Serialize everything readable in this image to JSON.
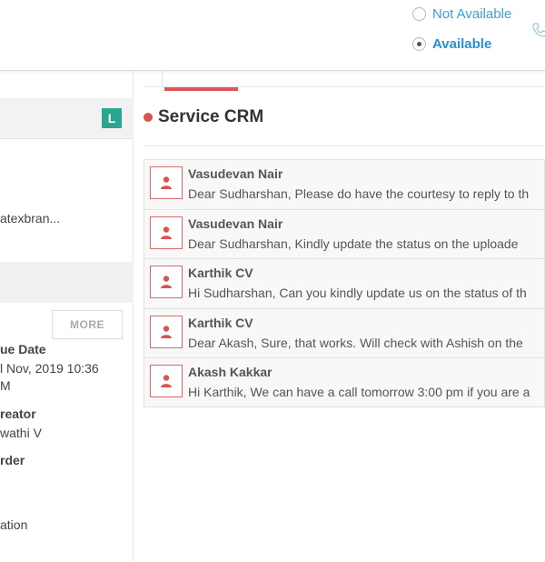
{
  "presence": {
    "options": [
      {
        "label": "Not Available",
        "selected": false
      },
      {
        "label": "Available",
        "selected": true
      }
    ]
  },
  "left_panel": {
    "badge": "L",
    "field_1": "atexbran...",
    "more_button": "MORE",
    "due_date_label": "ue Date",
    "due_date_value_1": "l  Nov, 2019 10:36",
    "due_date_value_2": "M",
    "creator_label": "reator",
    "creator_value": "wathi V",
    "order_label": "rder",
    "last_value": "ation"
  },
  "main": {
    "title": "Service CRM",
    "messages": [
      {
        "name": "Vasudevan Nair",
        "text": "Dear Sudharshan, Please do have the courtesy to reply to th"
      },
      {
        "name": "Vasudevan Nair",
        "text": "Dear Sudharshan,  Kindly update the status on the uploade"
      },
      {
        "name": "Karthik CV",
        "text": "Hi Sudharshan, Can you kindly update us on the status of th"
      },
      {
        "name": "Karthik CV",
        "text": "Dear Akash, Sure, that works. Will check with Ashish on the"
      },
      {
        "name": "Akash Kakkar",
        "text": "Hi Karthik, We can have a call tomorrow 3:00 pm if you are a"
      }
    ]
  },
  "colors": {
    "accent_red": "#d9534f",
    "badge_teal": "#2aa58f",
    "link_blue": "#3aa0d6"
  }
}
